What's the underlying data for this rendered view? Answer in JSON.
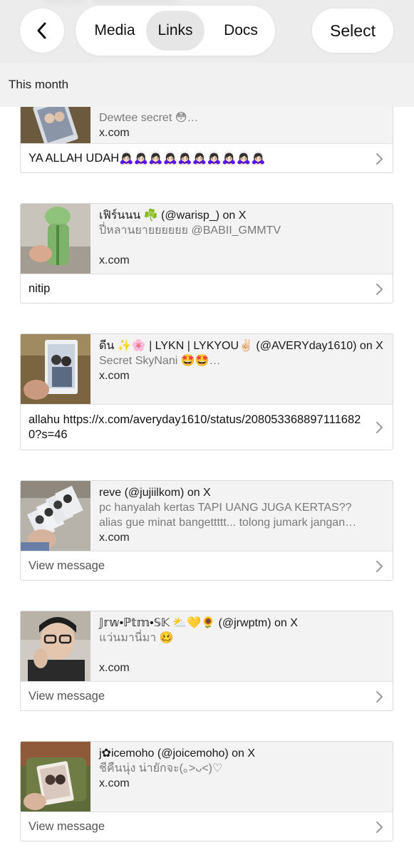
{
  "header": {
    "back_icon": "chevron-left-icon",
    "tabs": [
      {
        "label": "Media",
        "selected": false
      },
      {
        "label": "Links",
        "selected": true
      },
      {
        "label": "Docs",
        "selected": false
      }
    ],
    "select_label": "Select",
    "section_title": "This month"
  },
  "cards": [
    {
      "title": "",
      "description": "Dewtee secret 😳…",
      "domain": "x.com",
      "message": "YA ALLAH UDAH🙇🏻‍♀️🙇🏻‍♀️🙇🏻‍♀️🙇🏻‍♀️🙇🏻‍♀️🙇🏻‍♀️🙇🏻‍♀️🙇🏻‍♀️🙇🏻‍♀️🙇🏻‍♀️",
      "message_muted": false
    },
    {
      "title": "เฟิร์นนน ☘️ (@warisp_) on X",
      "description": "ปี่หลานยายยยยยย @BABII_GMMTV",
      "domain": "x.com",
      "message": "nitip",
      "message_muted": false
    },
    {
      "title": "ดีน ✨🌸 | LYKN | LYKYOU✌🏻 (@AVERYday1610) on X",
      "description": "Secret SkyNani 🤩🤩…",
      "domain": "x.com",
      "message": "allahu https://x.com/averyday1610/status/2080533688971116820?s=46",
      "message_muted": false
    },
    {
      "title": "reve (@jujiilkom) on X",
      "description": "pc hanyalah kertas TAPI UANG JUGA KERTAS??\nalias gue minat bangettttt... tolong jumark jangan…",
      "domain": "x.com",
      "message": "View message",
      "message_muted": true
    },
    {
      "title": "𝕁𝕣𝕨•ℙ𝕥𝕞•𝕊𝕂 ⛅💛🌻 (@jrwptm) on X",
      "description": "แว่นมานี่มา 🥴",
      "domain": "x.com",
      "message": "View message",
      "message_muted": true
    },
    {
      "title": "j✿icemoho (@joicemoho) on X",
      "description": "ชีคืนนุ่ง น่ายักจะ(｡>ᴗ<)♡",
      "domain": "x.com",
      "message": "View message",
      "message_muted": true
    }
  ],
  "icons": {
    "chevron": "chevron-right-icon"
  },
  "colors": {
    "header_bg": "#ececec",
    "section_bg": "#f1f1f1",
    "preview_bg": "#f3f3f3",
    "selected_tab_bg": "#e6e6e6"
  }
}
